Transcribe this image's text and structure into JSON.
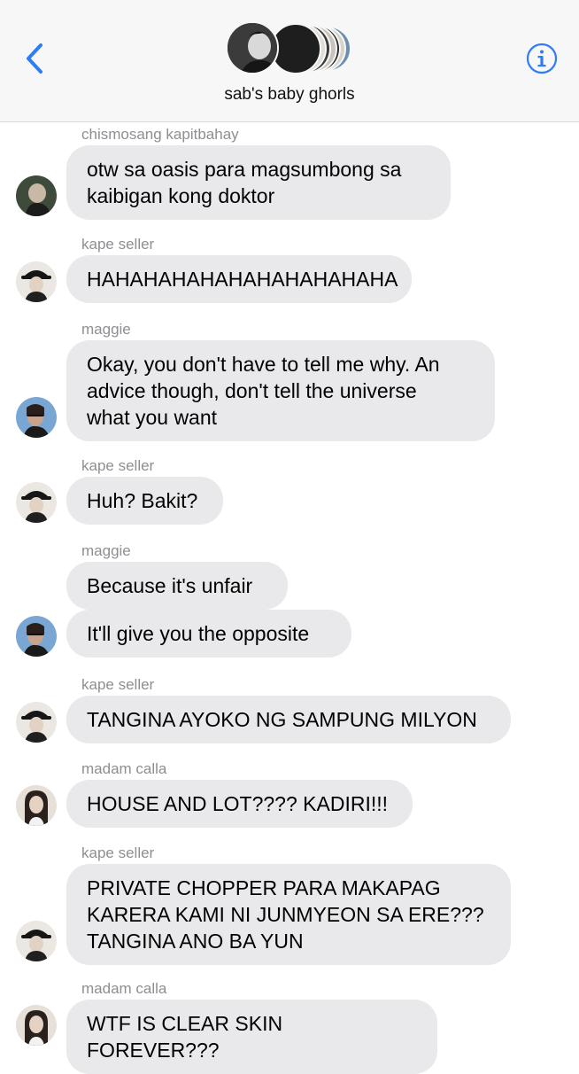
{
  "header": {
    "group_name": "sab's baby ghorls",
    "back_icon": "chevron-left-icon",
    "info_icon": "info-circle-icon",
    "accent_color": "#2f7cf6"
  },
  "messages": [
    {
      "sender": "chismosang kapitbahay",
      "text": "otw sa oasis para magsumbong sa\nkaibigan kong doktor"
    },
    {
      "sender": "kape seller",
      "text": "HAHAHAHAHAHAHAHAHAHAHA"
    },
    {
      "sender": "maggie",
      "text": "Okay, you don't have to tell me why. An\nadvice though, don't tell the universe\nwhat you want"
    },
    {
      "sender": "kape seller",
      "text": "Huh? Bakit?"
    },
    {
      "sender": "maggie",
      "text": "Because it's unfair"
    },
    {
      "sender": "",
      "text": "It'll give you the opposite"
    },
    {
      "sender": "kape seller",
      "text": "TANGINA AYOKO NG SAMPUNG MILYON"
    },
    {
      "sender": "madam calla",
      "text": "HOUSE AND LOT???? KADIRI!!!"
    },
    {
      "sender": "kape seller",
      "text": "PRIVATE CHOPPER PARA MAKAPAG\nKARERA KAMI NI JUNMYEON SA ERE???\nTANGINA ANO BA YUN"
    },
    {
      "sender": "madam calla",
      "text": "WTF IS CLEAR SKIN FOREVER???"
    }
  ]
}
